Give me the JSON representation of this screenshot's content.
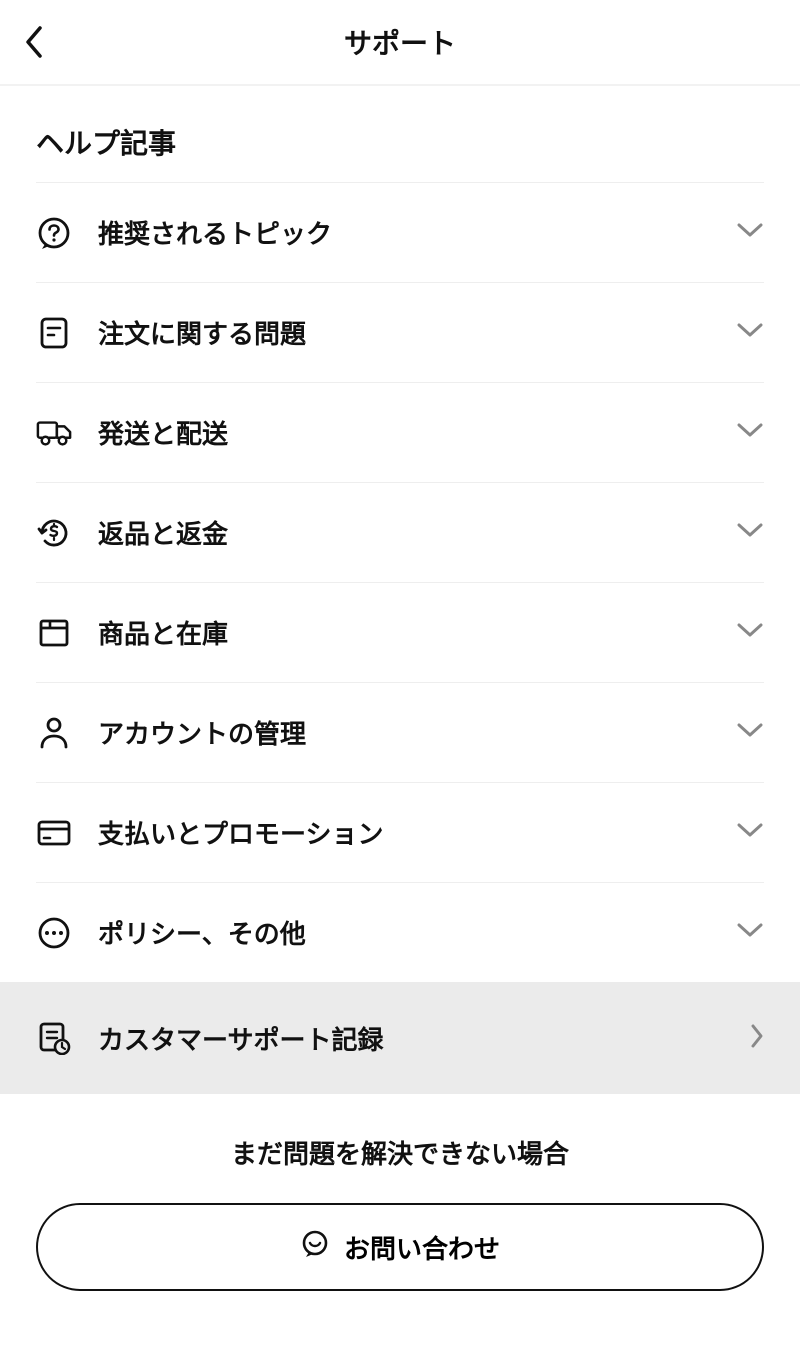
{
  "header": {
    "title": "サポート"
  },
  "section": {
    "title": "ヘルプ記事"
  },
  "categories": [
    {
      "label": "推奨されるトピック",
      "icon": "question-bubble"
    },
    {
      "label": "注文に関する問題",
      "icon": "note"
    },
    {
      "label": "発送と配送",
      "icon": "truck"
    },
    {
      "label": "返品と返金",
      "icon": "refund"
    },
    {
      "label": "商品と在庫",
      "icon": "box"
    },
    {
      "label": "アカウントの管理",
      "icon": "person"
    },
    {
      "label": "支払いとプロモーション",
      "icon": "card"
    },
    {
      "label": "ポリシー、その他",
      "icon": "more"
    }
  ],
  "record": {
    "label": "カスタマーサポート記録"
  },
  "footer": {
    "text": "まだ問題を解決できない場合",
    "button": "お問い合わせ"
  }
}
